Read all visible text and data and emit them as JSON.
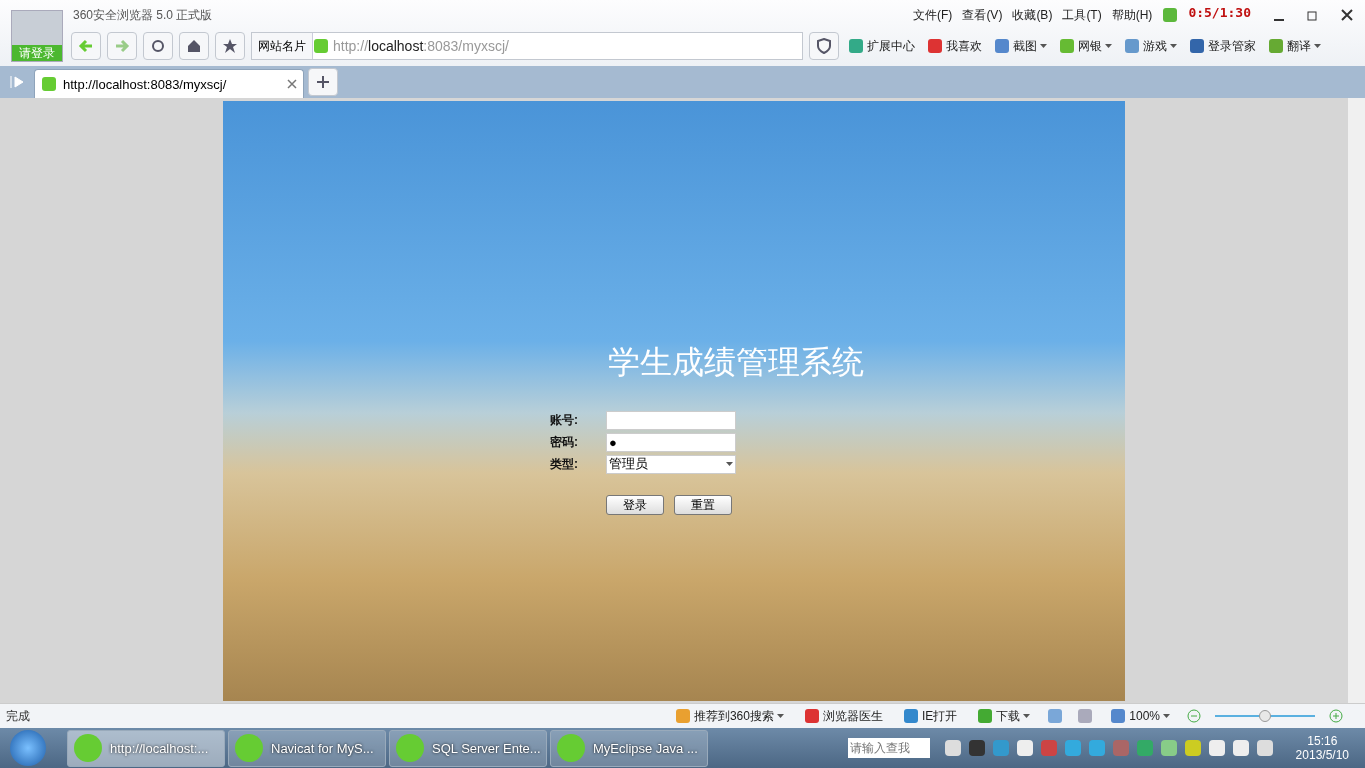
{
  "window": {
    "title": "360安全浏览器 5.0 正式版",
    "login_badge": "请登录",
    "recording_timer": "0:5/1:30"
  },
  "menu": [
    "文件(F)",
    "查看(V)",
    "收藏(B)",
    "工具(T)",
    "帮助(H)"
  ],
  "address_bar": {
    "site_card": "网站名片",
    "url_scheme": "http://",
    "url_host": "localhost",
    "url_rest": ":8083/myxscj/"
  },
  "toolbar": [
    {
      "label": "扩展中心",
      "kind": "plain"
    },
    {
      "label": "我喜欢",
      "kind": "plain"
    },
    {
      "label": "截图",
      "kind": "menu"
    },
    {
      "label": "网银",
      "kind": "menu"
    },
    {
      "label": "游戏",
      "kind": "menu"
    },
    {
      "label": "登录管家",
      "kind": "plain"
    },
    {
      "label": "翻译",
      "kind": "menu"
    }
  ],
  "tabs": [
    {
      "label": "http://localhost:8083/myxscj/",
      "selected": true
    }
  ],
  "page": {
    "title": "学生成绩管理系统",
    "fields": [
      {
        "label": "账号:",
        "kind": "text"
      },
      {
        "label": "密码:",
        "kind": "text",
        "value": "●"
      },
      {
        "label": "类型:",
        "kind": "select",
        "value": "管理员"
      }
    ],
    "buttons": [
      "登录",
      "重置"
    ]
  },
  "status_bar": {
    "text": "完成",
    "items": [
      {
        "label": "推荐到360搜索",
        "kind": "menu"
      },
      {
        "label": "浏览器医生",
        "kind": "plain"
      },
      {
        "label": "IE打开",
        "kind": "plain"
      },
      {
        "label": "下载",
        "kind": "menu"
      }
    ],
    "zoom": "100%",
    "zoom_level": {
      "level": 0.5
    }
  },
  "taskbar": {
    "apps": [
      {
        "label": "http://localhost:...",
        "selected": true
      },
      {
        "label": "Navicat for MyS...",
        "selected": false
      },
      {
        "label": "SQL Server Ente...",
        "selected": false
      },
      {
        "label": "MyEclipse Java ...",
        "selected": false
      }
    ],
    "search_placeholder": "请输入查我",
    "time": "15:16",
    "date": "2013/5/10"
  }
}
